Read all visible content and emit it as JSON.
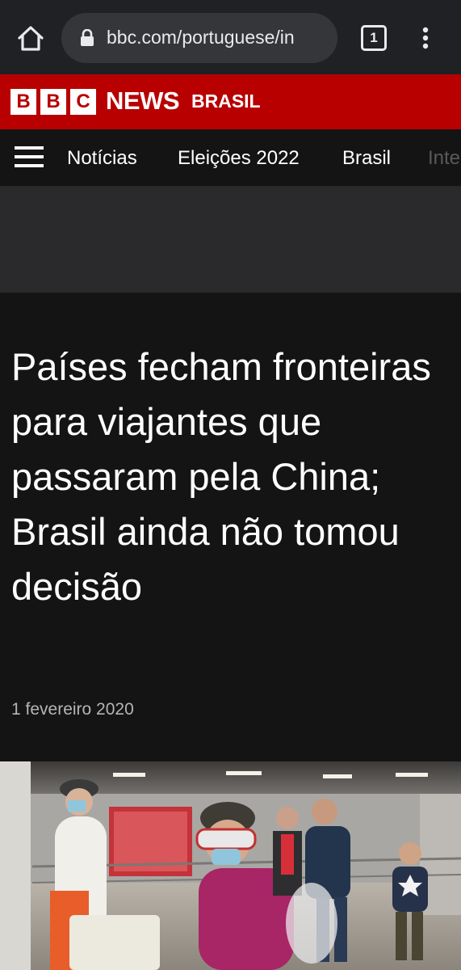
{
  "browser": {
    "url": "bbc.com/portuguese/in",
    "tab_count": "1"
  },
  "header": {
    "logo_letters": [
      "B",
      "B",
      "C"
    ],
    "brand": "NEWS",
    "edition": "BRASIL"
  },
  "nav": {
    "items": [
      "Notícias",
      "Eleições 2022",
      "Brasil",
      "Inte"
    ]
  },
  "article": {
    "headline": "Países fecham fronteiras para viajantes que passaram pela China; Brasil ainda não tomou decisão",
    "date": "1 fevereiro 2020"
  },
  "colors": {
    "bbc_red": "#b80000",
    "page_background": "#141414",
    "chrome": "#202124"
  }
}
